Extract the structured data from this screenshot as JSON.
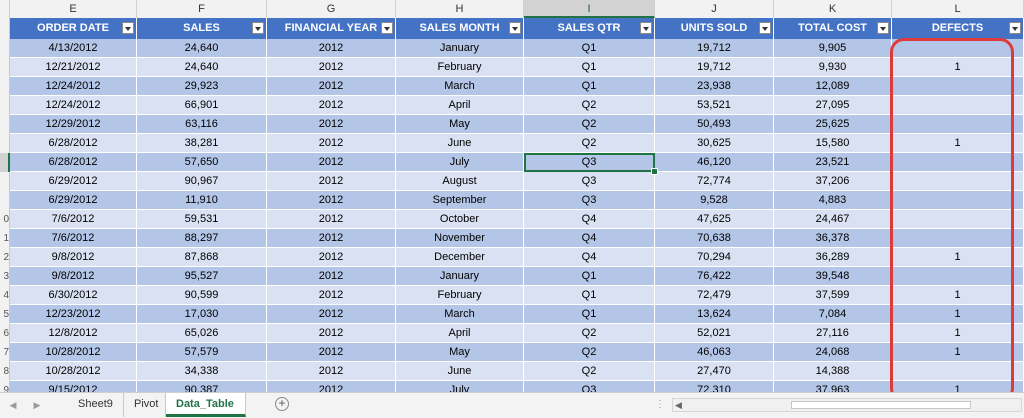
{
  "columns": [
    {
      "letter": "E",
      "header": "ORDER DATE"
    },
    {
      "letter": "F",
      "header": "SALES"
    },
    {
      "letter": "G",
      "header": "FINANCIAL YEAR"
    },
    {
      "letter": "H",
      "header": "SALES MONTH"
    },
    {
      "letter": "I",
      "header": "SALES QTR"
    },
    {
      "letter": "J",
      "header": "UNITS SOLD"
    },
    {
      "letter": "K",
      "header": "TOTAL COST"
    },
    {
      "letter": "L",
      "header": "DEFECTS"
    }
  ],
  "selected_column": "I",
  "row_numbers": [
    "",
    "",
    "",
    "",
    "",
    "",
    "",
    "",
    "",
    "0",
    "1",
    "2",
    "3",
    "4",
    "5",
    "6",
    "7",
    "8",
    "9",
    ""
  ],
  "rows": [
    [
      "4/13/2012",
      "24,640",
      "2012",
      "January",
      "Q1",
      "19,712",
      "9,905",
      ""
    ],
    [
      "12/21/2012",
      "24,640",
      "2012",
      "February",
      "Q1",
      "19,712",
      "9,930",
      "1"
    ],
    [
      "12/24/2012",
      "29,923",
      "2012",
      "March",
      "Q1",
      "23,938",
      "12,089",
      ""
    ],
    [
      "12/24/2012",
      "66,901",
      "2012",
      "April",
      "Q2",
      "53,521",
      "27,095",
      ""
    ],
    [
      "12/29/2012",
      "63,116",
      "2012",
      "May",
      "Q2",
      "50,493",
      "25,625",
      ""
    ],
    [
      "6/28/2012",
      "38,281",
      "2012",
      "June",
      "Q2",
      "30,625",
      "15,580",
      "1"
    ],
    [
      "6/28/2012",
      "57,650",
      "2012",
      "July",
      "Q3",
      "46,120",
      "23,521",
      ""
    ],
    [
      "6/29/2012",
      "90,967",
      "2012",
      "August",
      "Q3",
      "72,774",
      "37,206",
      ""
    ],
    [
      "6/29/2012",
      "11,910",
      "2012",
      "September",
      "Q3",
      "9,528",
      "4,883",
      ""
    ],
    [
      "7/6/2012",
      "59,531",
      "2012",
      "October",
      "Q4",
      "47,625",
      "24,467",
      ""
    ],
    [
      "7/6/2012",
      "88,297",
      "2012",
      "November",
      "Q4",
      "70,638",
      "36,378",
      ""
    ],
    [
      "9/8/2012",
      "87,868",
      "2012",
      "December",
      "Q4",
      "70,294",
      "36,289",
      "1"
    ],
    [
      "9/8/2012",
      "95,527",
      "2012",
      "January",
      "Q1",
      "76,422",
      "39,548",
      ""
    ],
    [
      "6/30/2012",
      "90,599",
      "2012",
      "February",
      "Q1",
      "72,479",
      "37,599",
      "1"
    ],
    [
      "12/23/2012",
      "17,030",
      "2012",
      "March",
      "Q1",
      "13,624",
      "7,084",
      "1"
    ],
    [
      "12/8/2012",
      "65,026",
      "2012",
      "April",
      "Q2",
      "52,021",
      "27,116",
      "1"
    ],
    [
      "10/28/2012",
      "57,579",
      "2012",
      "May",
      "Q2",
      "46,063",
      "24,068",
      "1"
    ],
    [
      "10/28/2012",
      "34,338",
      "2012",
      "June",
      "Q2",
      "27,470",
      "14,388",
      ""
    ],
    [
      "9/15/2012",
      "90,387",
      "2012",
      "July",
      "Q3",
      "72,310",
      "37,963",
      "1"
    ]
  ],
  "active_cell": {
    "row": 6,
    "col": 4
  },
  "tabs": [
    {
      "label": "Sheet9",
      "active": false
    },
    {
      "label": "Pivot",
      "active": false
    },
    {
      "label": "Data_Table",
      "active": true
    }
  ],
  "add_sheet_label": "+",
  "colors": {
    "header_fill": "#4472c4",
    "band_dark": "#b4c6e7",
    "band_light": "#d9e1f2",
    "excel_green": "#217346",
    "annotation_red": "#e03b3b"
  }
}
